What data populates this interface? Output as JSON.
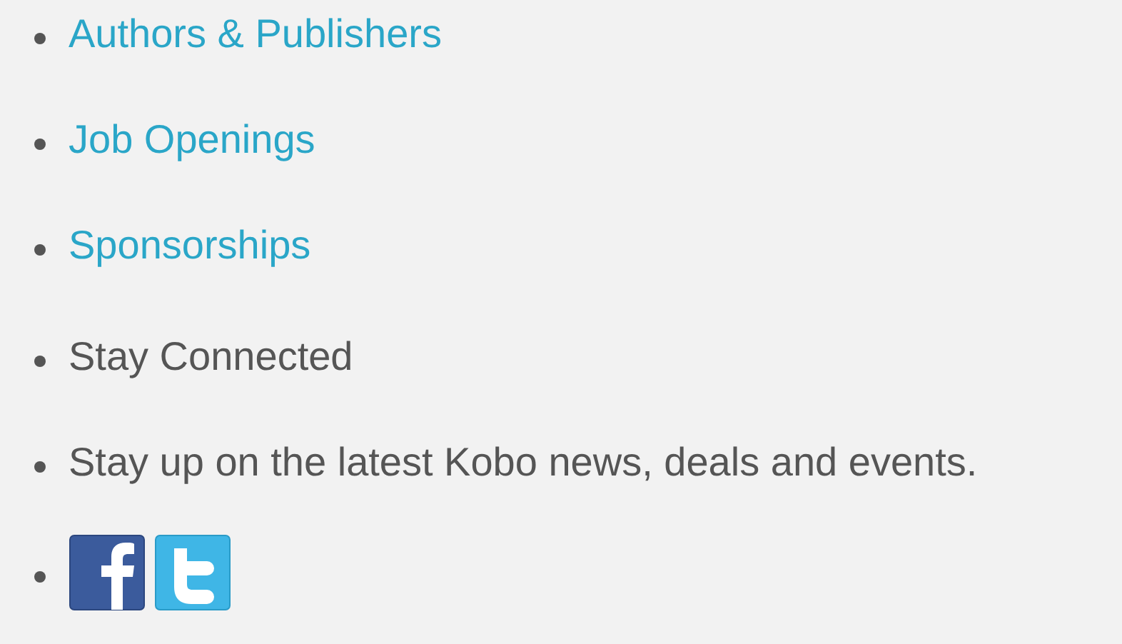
{
  "links": [
    {
      "label": "Authors & Publishers"
    },
    {
      "label": "Job Openings"
    },
    {
      "label": "Sponsorships"
    }
  ],
  "stay_connected": {
    "heading": "Stay Connected",
    "text": "Stay up on the latest Kobo news, deals and events."
  }
}
